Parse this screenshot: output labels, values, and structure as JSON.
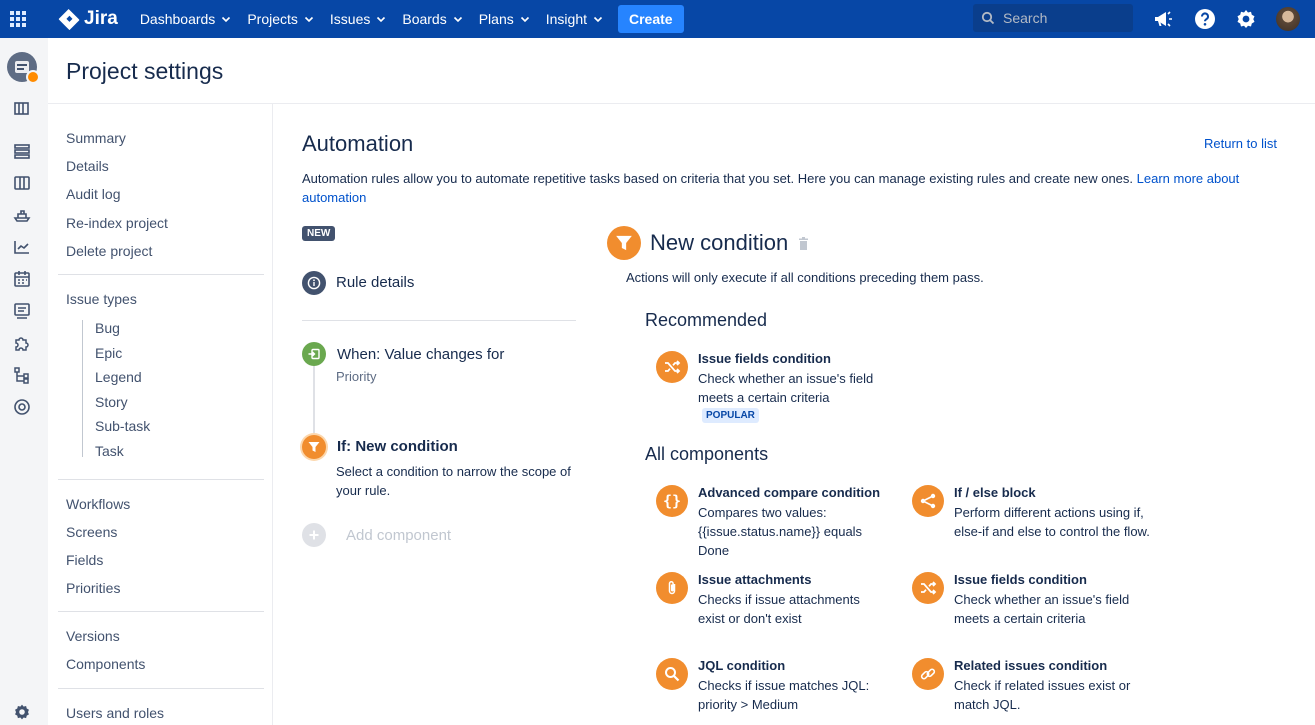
{
  "nav": {
    "logo": "Jira",
    "items": [
      "Dashboards",
      "Projects",
      "Issues",
      "Boards",
      "Plans",
      "Insight"
    ],
    "create": "Create",
    "search_placeholder": "Search"
  },
  "page": {
    "title": "Project settings"
  },
  "sidebar": {
    "group1": [
      "Summary",
      "Details",
      "Audit log",
      "Re-index project",
      "Delete project"
    ],
    "issue_types_label": "Issue types",
    "issue_types": [
      "Bug",
      "Epic",
      "Legend",
      "Story",
      "Sub-task",
      "Task"
    ],
    "group3": [
      "Workflows",
      "Screens",
      "Fields",
      "Priorities"
    ],
    "group4": [
      "Versions",
      "Components"
    ],
    "group5": [
      "Users and roles"
    ]
  },
  "main": {
    "title": "Automation",
    "return_link": "Return to list",
    "description": "Automation rules allow you to automate repetitive tasks based on criteria that you set. Here you can manage existing rules and create new ones.",
    "learn_more": "Learn more about automation",
    "new_badge": "NEW"
  },
  "rule": {
    "details": "Rule details",
    "trigger_title": "When: Value changes for",
    "trigger_sub": "Priority",
    "condition_title": "If: New condition",
    "condition_sub": "Select a condition to narrow the scope of your rule.",
    "add_component": "Add component"
  },
  "panel": {
    "title": "New condition",
    "subtitle": "Actions will only execute if all conditions preceding them pass.",
    "recommended_label": "Recommended",
    "all_label": "All components",
    "popular_badge": "POPULAR",
    "recommended": [
      {
        "title": "Issue fields condition",
        "desc": "Check whether an issue's field meets a certain criteria",
        "icon": "shuffle-icon"
      }
    ],
    "components": [
      {
        "title": "Advanced compare condition",
        "desc": "Compares two values: {{issue.status.name}} equals Done",
        "icon": "braces-icon"
      },
      {
        "title": "If / else block",
        "desc": "Perform different actions using if, else-if and else to control the flow.",
        "icon": "branch-icon"
      },
      {
        "title": "Issue attachments",
        "desc": "Checks if issue attachments exist or don't exist",
        "icon": "paperclip-icon"
      },
      {
        "title": "Issue fields condition",
        "desc": "Check whether an issue's field meets a certain criteria",
        "icon": "shuffle-icon"
      },
      {
        "title": "JQL condition",
        "desc": "Checks if issue matches JQL: priority > Medium",
        "icon": "magnifier-icon"
      },
      {
        "title": "Related issues condition",
        "desc": "Check if related issues exist or match JQL.",
        "icon": "link-icon"
      }
    ]
  },
  "colors": {
    "nav_bg": "#0747a6",
    "accent_orange": "#f18d2e",
    "trigger_green": "#6aa84f",
    "link_blue": "#0052cc"
  }
}
